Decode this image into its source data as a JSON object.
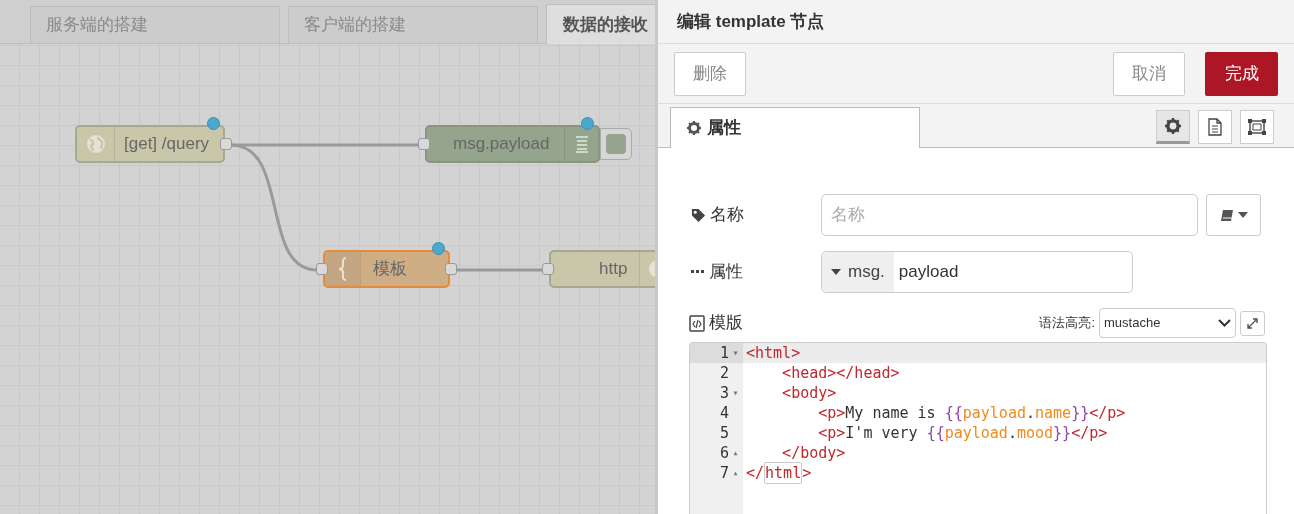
{
  "flow_tabs": [
    {
      "label": "服务端的搭建",
      "selected": false
    },
    {
      "label": "客户端的搭建",
      "selected": false
    },
    {
      "label": "数据的接收",
      "selected": true
    }
  ],
  "nodes": [
    {
      "kind": "http-in",
      "label": "[get] /query",
      "changed": true
    },
    {
      "kind": "debug",
      "label": "msg.payload",
      "changed": true
    },
    {
      "kind": "template",
      "label": "模板",
      "changed": true,
      "selected": true
    },
    {
      "kind": "http-response",
      "label": "http",
      "changed": false
    }
  ],
  "editor": {
    "title": "编辑 template 节点",
    "buttons": [
      {
        "kind": "delete",
        "label": "删除"
      },
      {
        "kind": "cancel",
        "label": "取消"
      },
      {
        "kind": "done",
        "label": "完成"
      }
    ],
    "tabs": [
      {
        "label": "属性",
        "selected": true
      }
    ],
    "tab_icons": [
      {
        "kind": "gear",
        "selected": true
      },
      {
        "kind": "document",
        "selected": false
      },
      {
        "kind": "frame",
        "selected": false
      }
    ],
    "name_field": {
      "label": "名称",
      "placeholder": "名称"
    },
    "property_field": {
      "label": "属性",
      "prefix": "msg.",
      "value": "payload"
    },
    "template_label": "模版",
    "syntax": {
      "label": "语法高亮:",
      "value": "mustache"
    },
    "code": [
      {
        "number": "1",
        "fold": "▾",
        "active": true,
        "tokens": [
          {
            "kind": "tag",
            "text": "<html>"
          }
        ]
      },
      {
        "number": "2",
        "active": false,
        "tokens": [
          {
            "kind": "tag",
            "text": "    <head></head>"
          }
        ]
      },
      {
        "number": "3",
        "fold": "▾",
        "active": false,
        "tokens": [
          {
            "kind": "tag",
            "text": "    <body>"
          }
        ]
      },
      {
        "number": "4",
        "active": false,
        "tokens": [
          {
            "kind": "tag",
            "text": "        <p>"
          },
          {
            "kind": "plain",
            "text": "My name is "
          },
          {
            "kind": "brace",
            "text": "{{"
          },
          {
            "kind": "var",
            "text": "payload"
          },
          {
            "kind": "plain",
            "text": "."
          },
          {
            "kind": "var",
            "text": "name"
          },
          {
            "kind": "brace",
            "text": "}}"
          },
          {
            "kind": "tag",
            "text": "</p>"
          }
        ]
      },
      {
        "number": "5",
        "active": false,
        "tokens": [
          {
            "kind": "tag",
            "text": "        <p>"
          },
          {
            "kind": "plain",
            "text": "I'm very "
          },
          {
            "kind": "brace",
            "text": "{{"
          },
          {
            "kind": "var",
            "text": "payload"
          },
          {
            "kind": "plain",
            "text": "."
          },
          {
            "kind": "var",
            "text": "mood"
          },
          {
            "kind": "brace",
            "text": "}}"
          },
          {
            "kind": "tag",
            "text": "</p>"
          }
        ]
      },
      {
        "number": "6",
        "fold": "▴",
        "active": false,
        "tokens": [
          {
            "kind": "tag",
            "text": "    </body>"
          }
        ]
      },
      {
        "number": "7",
        "fold": "▴",
        "active": false,
        "tokens": [
          {
            "kind": "tag",
            "text": "</"
          },
          {
            "kind": "match",
            "text": "html"
          },
          {
            "kind": "tag",
            "text": ">"
          }
        ]
      }
    ]
  }
}
